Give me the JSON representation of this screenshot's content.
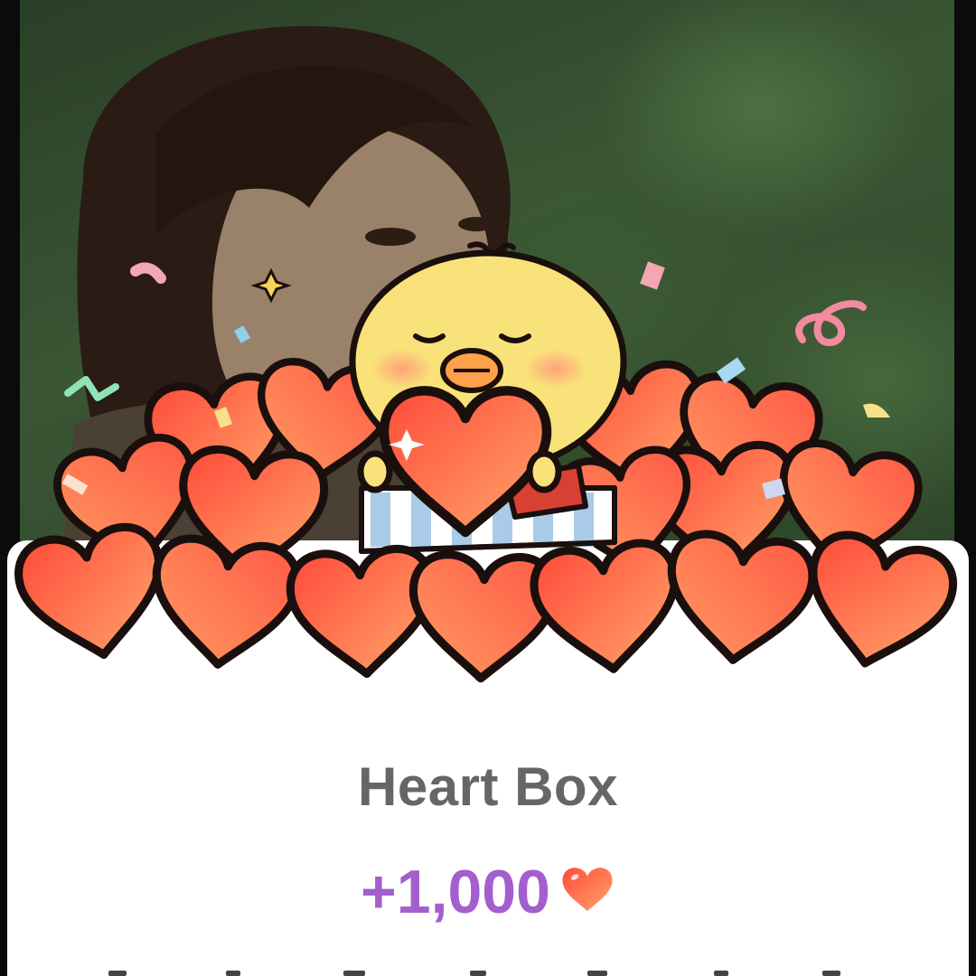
{
  "reward_box": {
    "title": "Heart Box",
    "amount": "+1,000",
    "currency_icon": "heart-icon"
  },
  "colors": {
    "title": "#666666",
    "amount": "#a35fcd",
    "heart_gradient_start": "#ff4d3d",
    "heart_gradient_end": "#ffa46a",
    "chick": "#f9e27a"
  }
}
